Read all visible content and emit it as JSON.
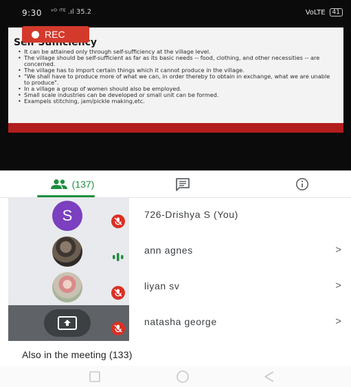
{
  "status_bar": {
    "time": "9:30",
    "signal_text": "ᵛᴼ ˡᵀᴱ .ıl 35.2",
    "right_text": "VoLTE",
    "battery": "41"
  },
  "slide": {
    "title": "Self Sufficiency",
    "bullets": [
      "It can be attained only through self-sufficiency at the village level.",
      "The village should be self-sufficient as far as its basic needs -- food, clothing, and other necessities -- are concerned.",
      "The village has to import certain things which it cannot produce in the village.",
      "\"We shall have to produce more of what we can, in order thereby to obtain in exchange, what we are unable to produce\".",
      "In a village a group of women should also be employed.",
      "Small scale industries can be developed or small unit can be formed.",
      "Exampels stitching, jam/pickle making,etc."
    ]
  },
  "recording": {
    "label": "REC"
  },
  "tabs": {
    "people_count": "(137)"
  },
  "participants": [
    {
      "initial": "S",
      "name": "726-Drishya S (You)",
      "avatar_color": "#7b3fbf",
      "mic": "muted",
      "chevron": ""
    },
    {
      "name": "ann agnes",
      "mic": "speaking",
      "chevron": ">"
    },
    {
      "name": "liyan sv",
      "mic": "muted",
      "chevron": ">"
    },
    {
      "name": "natasha george",
      "mic": "muted",
      "chevron": ">",
      "presenting": true
    }
  ],
  "also_in_meeting": "Also in the meeting (133)",
  "colors": {
    "accent_green": "#1e8e3e",
    "mute_red": "#d93025",
    "rec_red": "#d33a2c",
    "slide_footer_red": "#b21d1d"
  },
  "icons": [
    "people-icon",
    "chat-icon",
    "info-icon",
    "mic-off-icon",
    "speaking-icon",
    "present-screen-icon",
    "recent-apps-icon",
    "home-icon",
    "back-icon"
  ]
}
